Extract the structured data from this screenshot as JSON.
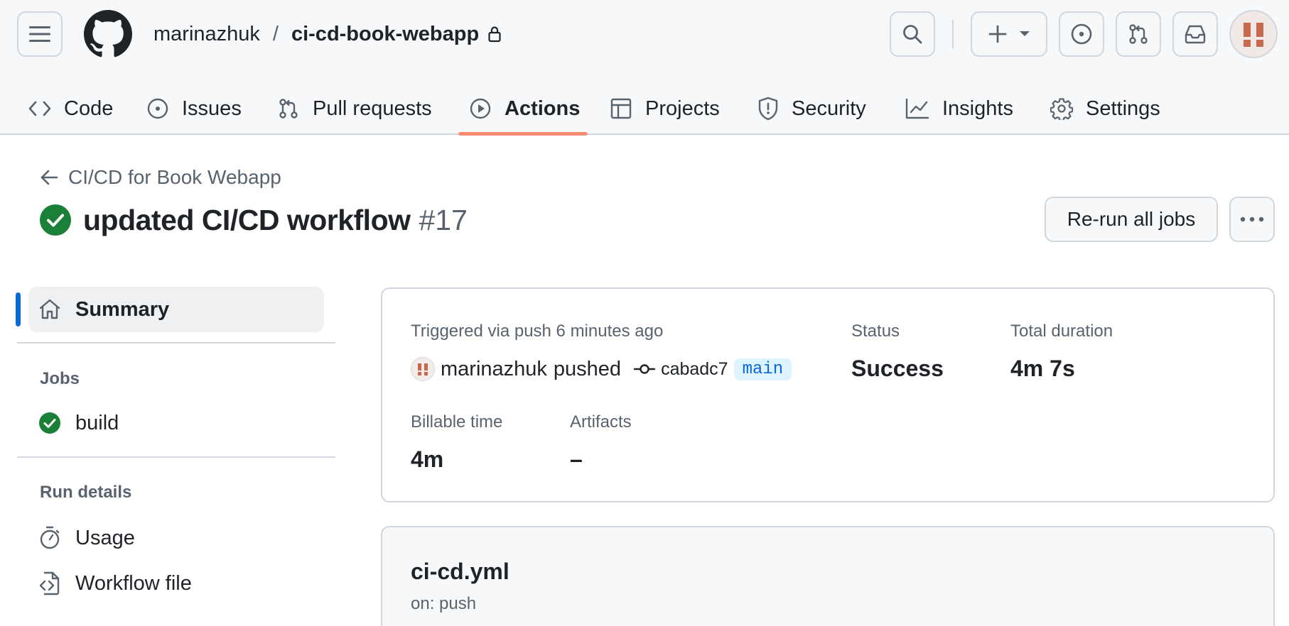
{
  "header": {
    "owner": "marinazhuk",
    "separator": "/",
    "repo": "ci-cd-book-webapp"
  },
  "tabs": [
    {
      "label": "Code",
      "icon": "code-icon"
    },
    {
      "label": "Issues",
      "icon": "issue-opened-icon"
    },
    {
      "label": "Pull requests",
      "icon": "git-pull-request-icon"
    },
    {
      "label": "Actions",
      "icon": "play-icon",
      "active": true
    },
    {
      "label": "Projects",
      "icon": "table-icon"
    },
    {
      "label": "Security",
      "icon": "shield-icon"
    },
    {
      "label": "Insights",
      "icon": "graph-icon"
    },
    {
      "label": "Settings",
      "icon": "gear-icon"
    }
  ],
  "run": {
    "back_label": "CI/CD for Book Webapp",
    "title": "updated CI/CD workflow",
    "number": "#17",
    "rerun_label": "Re-run all jobs"
  },
  "sidebar": {
    "summary_label": "Summary",
    "jobs_heading": "Jobs",
    "jobs": [
      {
        "label": "build",
        "status": "success"
      }
    ],
    "run_details_heading": "Run details",
    "details": [
      {
        "label": "Usage",
        "icon": "stopwatch-icon"
      },
      {
        "label": "Workflow file",
        "icon": "file-code-icon"
      }
    ]
  },
  "summary": {
    "triggered": "Triggered via push 6 minutes ago",
    "actor": "marinazhuk",
    "action": "pushed",
    "commit_sha": "cabadc7",
    "branch": "main",
    "status_label": "Status",
    "status_value": "Success",
    "duration_label": "Total duration",
    "duration_value": "4m 7s",
    "billable_label": "Billable time",
    "billable_value": "4m",
    "artifacts_label": "Artifacts",
    "artifacts_value": "–"
  },
  "workflow": {
    "file": "ci-cd.yml",
    "on": "on: push"
  },
  "colors": {
    "success": "#1a7f37",
    "accent_underline": "#fd8c73",
    "link": "#0969da",
    "avatar_mark": "#c8694f"
  }
}
